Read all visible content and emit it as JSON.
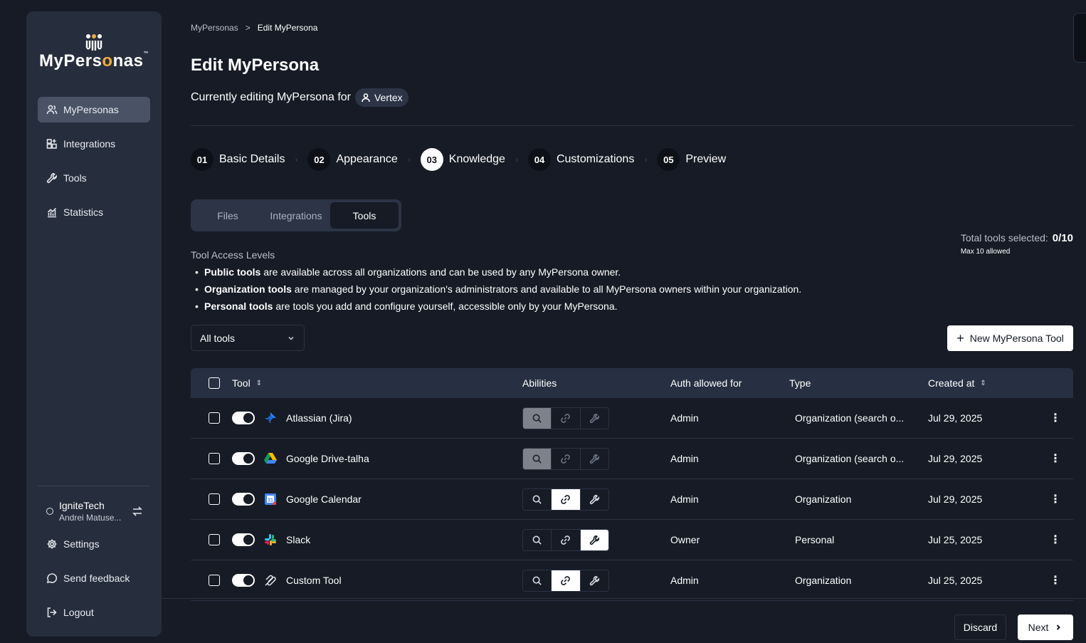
{
  "brand": {
    "name_prefix": "MyPers",
    "name_o": "o",
    "name_suffix": "nas",
    "tm": "™"
  },
  "sidebar": {
    "items": [
      {
        "label": "MyPersonas",
        "icon": "users-icon",
        "active": true
      },
      {
        "label": "Integrations",
        "icon": "grid-plus-icon",
        "active": false
      },
      {
        "label": "Tools",
        "icon": "wrench-icon",
        "active": false
      },
      {
        "label": "Statistics",
        "icon": "chart-icon",
        "active": false
      }
    ],
    "org": {
      "name": "IgniteTech",
      "user": "Andrei Matuse..."
    },
    "bottom": [
      {
        "label": "Settings",
        "icon": "gear-icon"
      },
      {
        "label": "Send feedback",
        "icon": "chat-icon"
      },
      {
        "label": "Logout",
        "icon": "logout-icon"
      }
    ]
  },
  "breadcrumb": {
    "root": "MyPersonas",
    "separator": ">",
    "current": "Edit MyPersona"
  },
  "page_title": "Edit MyPersona",
  "editing": {
    "text": "Currently editing MyPersona for",
    "persona": "Vertex"
  },
  "steps": [
    {
      "num": "01",
      "label": "Basic Details",
      "active": false
    },
    {
      "num": "02",
      "label": "Appearance",
      "active": false
    },
    {
      "num": "03",
      "label": "Knowledge",
      "active": true
    },
    {
      "num": "04",
      "label": "Customizations",
      "active": false
    },
    {
      "num": "05",
      "label": "Preview",
      "active": false
    }
  ],
  "tabs": [
    {
      "label": "Files",
      "active": false
    },
    {
      "label": "Integrations",
      "active": false
    },
    {
      "label": "Tools",
      "active": true
    }
  ],
  "total": {
    "label": "Total tools selected:",
    "value": "0/10",
    "sub": "Max 10 allowed"
  },
  "access": {
    "title": "Tool Access Levels",
    "items": [
      {
        "bold": "Public tools",
        "text": " are available across all organizations and can be used by any MyPersona owner."
      },
      {
        "bold": "Organization tools",
        "text": " are managed by your organization's administrators and available to all MyPersona owners within your organization."
      },
      {
        "bold": "Personal tools",
        "text": " are tools you add and configure yourself, accessible only by your MyPersona."
      }
    ]
  },
  "filter": {
    "value": "All tools"
  },
  "new_button": {
    "label": "New MyPersona Tool"
  },
  "table": {
    "headers": {
      "tool": "Tool",
      "abilities": "Abilities",
      "auth": "Auth allowed for",
      "type": "Type",
      "created": "Created at"
    },
    "rows": [
      {
        "name": "Atlassian (Jira)",
        "icon": "jira-icon",
        "abilities": [
          "grey",
          "dim",
          "dim"
        ],
        "auth": "Admin",
        "type": "Organization (search o...",
        "created": "Jul 29, 2025"
      },
      {
        "name": "Google Drive-talha",
        "icon": "google-drive-icon",
        "abilities": [
          "grey",
          "dim",
          "dim"
        ],
        "auth": "Admin",
        "type": "Organization (search o...",
        "created": "Jul 29, 2025"
      },
      {
        "name": "Google Calendar",
        "icon": "google-calendar-icon",
        "abilities": [
          "off",
          "white",
          "off"
        ],
        "auth": "Admin",
        "type": "Organization",
        "created": "Jul 29, 2025"
      },
      {
        "name": "Slack",
        "icon": "slack-icon",
        "abilities": [
          "off",
          "off",
          "white"
        ],
        "auth": "Owner",
        "type": "Personal",
        "created": "Jul 25, 2025"
      },
      {
        "name": "Custom Tool",
        "icon": "custom-tool-icon",
        "abilities": [
          "off",
          "white",
          "off"
        ],
        "auth": "Admin",
        "type": "Organization",
        "created": "Jul 25, 2025"
      }
    ]
  },
  "footer": {
    "discard": "Discard",
    "next": "Next"
  },
  "colors": {
    "background": "#161b25",
    "sidebar": "#262d3c",
    "accent": "#f2a93b",
    "active_nav": "#4a5366"
  }
}
